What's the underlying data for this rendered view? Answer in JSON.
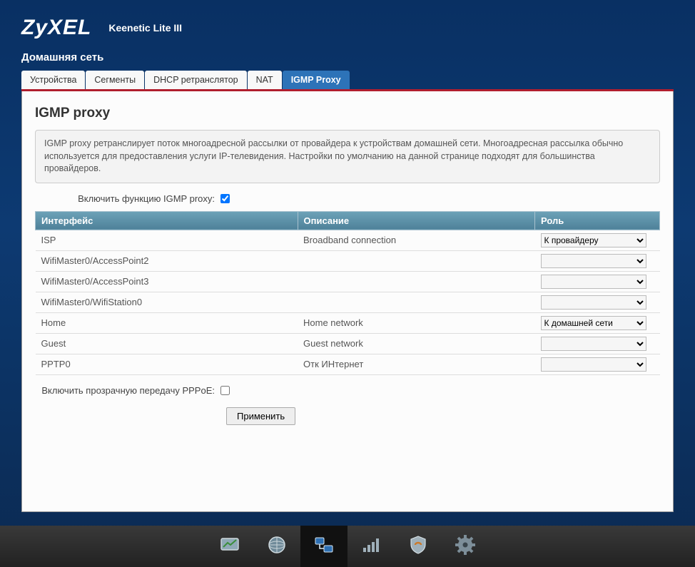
{
  "brand": "ZyXEL",
  "model": "Keenetic Lite III",
  "breadcrumb": "Домашняя сеть",
  "tabs": [
    {
      "label": "Устройства",
      "active": false
    },
    {
      "label": "Сегменты",
      "active": false
    },
    {
      "label": "DHCP ретранслятор",
      "active": false
    },
    {
      "label": "NAT",
      "active": false
    },
    {
      "label": "IGMP Proxy",
      "active": true
    }
  ],
  "page": {
    "title": "IGMP proxy",
    "help": "IGMP proxy ретранслирует поток многоадресной рассылки от провайдера к устройствам домашней сети. Многоадресная рассылка обычно используется для предоставления услуги IP-телевидения. Настройки по умолчанию на данной странице подходят для большинства провайдеров.",
    "enable_label": "Включить функцию IGMP proxy:",
    "enable_checked": true,
    "pppoe_label": "Включить прозрачную передачу PPPoE:",
    "pppoe_checked": false,
    "apply_label": "Применить",
    "columns": {
      "iface": "Интерфейс",
      "desc": "Описание",
      "role": "Роль"
    },
    "role_options": [
      "",
      "К провайдеру",
      "К домашней сети"
    ],
    "rows": [
      {
        "iface": "ISP",
        "desc": "Broadband connection",
        "role": "К провайдеру"
      },
      {
        "iface": "WifiMaster0/AccessPoint2",
        "desc": "",
        "role": ""
      },
      {
        "iface": "WifiMaster0/AccessPoint3",
        "desc": "",
        "role": ""
      },
      {
        "iface": "WifiMaster0/WifiStation0",
        "desc": "",
        "role": ""
      },
      {
        "iface": "Home",
        "desc": "Home network",
        "role": "К домашней сети"
      },
      {
        "iface": "Guest",
        "desc": "Guest network",
        "role": ""
      },
      {
        "iface": "PPTP0",
        "desc": "Отк ИНтернет",
        "role": ""
      }
    ]
  },
  "bottombar": [
    {
      "name": "monitor-icon",
      "active": false
    },
    {
      "name": "globe-icon",
      "active": false
    },
    {
      "name": "network-icon",
      "active": true
    },
    {
      "name": "signal-icon",
      "active": false
    },
    {
      "name": "shield-icon",
      "active": false
    },
    {
      "name": "gear-icon",
      "active": false
    }
  ]
}
